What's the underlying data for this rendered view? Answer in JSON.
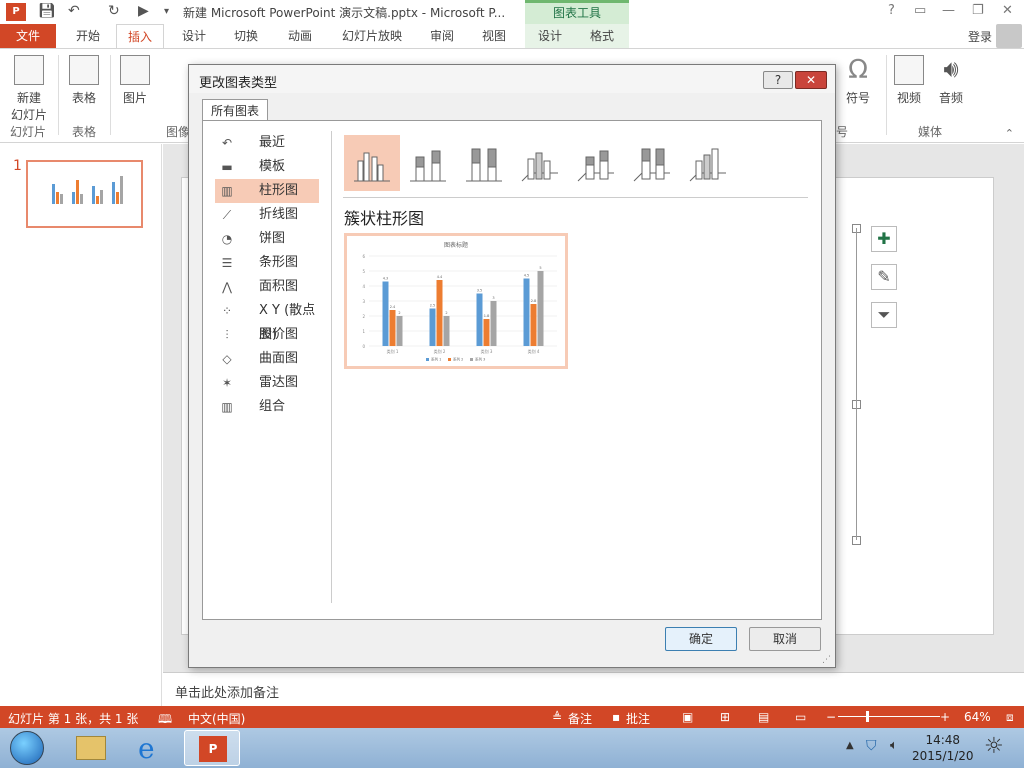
{
  "window": {
    "title": "新建 Microsoft PowerPoint 演示文稿.pptx - Microsoft P...",
    "context_tab_header": "图表工具",
    "login": "登录",
    "app_icon_label": "P"
  },
  "ribbon": {
    "tabs": [
      "文件",
      "开始",
      "插入",
      "设计",
      "切换",
      "动画",
      "幻灯片放映",
      "审阅",
      "视图",
      "设计",
      "格式"
    ],
    "active_tab": "插入",
    "buttons": {
      "new_slide": "新建",
      "new_slide_sub": "幻灯片",
      "table": "表格",
      "picture": "图片",
      "symbol": "符号",
      "video": "视频",
      "audio": "音频"
    },
    "groups": {
      "slides": "幻灯片",
      "tables": "表格",
      "images": "图像",
      "symbols": "号",
      "media": "媒体"
    }
  },
  "slides_pane": {
    "slide_number": "1"
  },
  "notes": {
    "placeholder": "单击此处添加备注"
  },
  "statusbar": {
    "slide_info": "幻灯片 第 1 张，共 1 张",
    "language": "中文(中国)",
    "notes_btn": "备注",
    "comments_btn": "批注",
    "zoom": "64%"
  },
  "taskbar": {
    "time": "14:48",
    "date": "2015/1/20"
  },
  "dialog": {
    "title": "更改图表类型",
    "help_label": "?",
    "close_label": "✕",
    "tab": "所有图表",
    "chart_types": [
      {
        "label": "最近",
        "icon": "recent-icon",
        "glyph": "↶"
      },
      {
        "label": "模板",
        "icon": "folder-icon",
        "glyph": "▬"
      },
      {
        "label": "柱形图",
        "icon": "column-chart-icon",
        "glyph": "▥"
      },
      {
        "label": "折线图",
        "icon": "line-chart-icon",
        "glyph": "⟋"
      },
      {
        "label": "饼图",
        "icon": "pie-chart-icon",
        "glyph": "◔"
      },
      {
        "label": "条形图",
        "icon": "bar-chart-icon",
        "glyph": "☰"
      },
      {
        "label": "面积图",
        "icon": "area-chart-icon",
        "glyph": "⋀"
      },
      {
        "label": "X Y (散点图)",
        "icon": "scatter-chart-icon",
        "glyph": "⁘"
      },
      {
        "label": "股价图",
        "icon": "stock-chart-icon",
        "glyph": "⫶"
      },
      {
        "label": "曲面图",
        "icon": "surface-chart-icon",
        "glyph": "◇"
      },
      {
        "label": "雷达图",
        "icon": "radar-chart-icon",
        "glyph": "✶"
      },
      {
        "label": "组合",
        "icon": "combo-chart-icon",
        "glyph": "▥"
      }
    ],
    "selected_type": "柱形图",
    "subtype_name": "簇状柱形图",
    "ok_label": "确定",
    "cancel_label": "取消"
  },
  "preview_chart": {
    "title": "图表标题",
    "categories": [
      "类别 1",
      "类别 2",
      "类别 3",
      "类别 4"
    ],
    "series": [
      {
        "name": "系列 1",
        "values": [
          4.3,
          2.5,
          3.5,
          4.5
        ],
        "color": "#5b9bd5"
      },
      {
        "name": "系列 2",
        "values": [
          2.4,
          4.4,
          1.8,
          2.8
        ],
        "color": "#ed7d31"
      },
      {
        "name": "系列 3",
        "values": [
          2,
          2,
          3,
          5
        ],
        "color": "#a5a5a5"
      }
    ],
    "ylim": [
      0,
      6
    ]
  }
}
